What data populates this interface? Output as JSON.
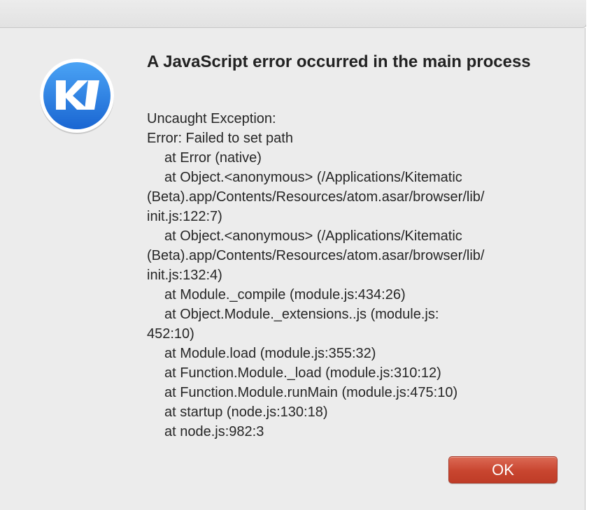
{
  "dialog": {
    "title": "A JavaScript error occurred in the main process",
    "message_lines": [
      "Uncaught Exception:",
      "Error: Failed to set path",
      "at Error (native)",
      "at Object.<anonymous> (/Applications/Kitematic",
      "(Beta).app/Contents/Resources/atom.asar/browser/lib/",
      "init.js:122:7)",
      "at Object.<anonymous> (/Applications/Kitematic",
      "(Beta).app/Contents/Resources/atom.asar/browser/lib/",
      "init.js:132:4)",
      "at Module._compile (module.js:434:26)",
      "at Object.Module._extensions..js (module.js:",
      "452:10)",
      "at Module.load (module.js:355:32)",
      "at Function.Module._load (module.js:310:12)",
      "at Function.Module.runMain (module.js:475:10)",
      "at startup (node.js:130:18)",
      "at node.js:982:3"
    ],
    "ok_label": "OK",
    "icon": {
      "name": "kitematic-app-icon",
      "letters": "KI"
    }
  },
  "colors": {
    "dialog_background": "#ececec",
    "icon_blue": "#2b82e6",
    "ok_button_red": "#c8452f",
    "text": "#262626"
  }
}
